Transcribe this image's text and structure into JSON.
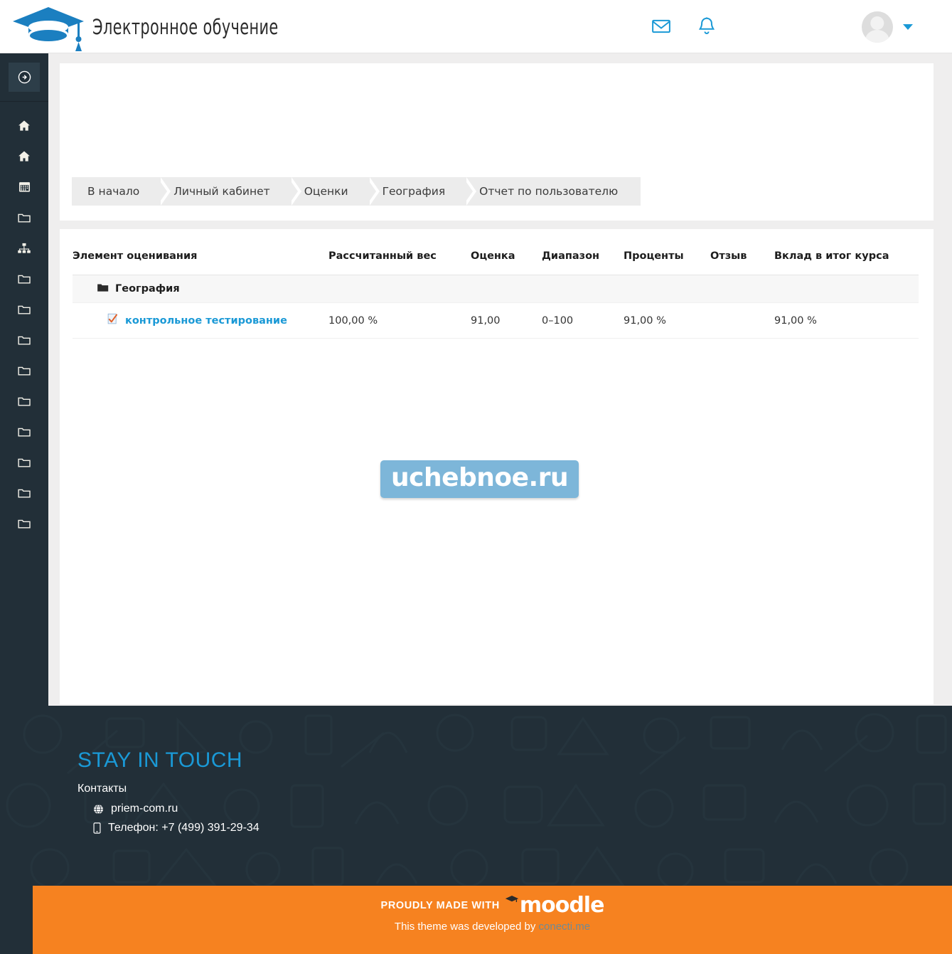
{
  "header": {
    "brand_name": "Электронное обучение",
    "logo_icon": "graduation-cap-icon",
    "messages_icon": "envelope-icon",
    "notifications_icon": "bell-icon",
    "avatar_icon": "user-avatar-icon",
    "caret_icon": "chevron-down-icon"
  },
  "sidebar": {
    "toggle_icon": "arrow-right-circle-icon",
    "items": [
      {
        "icon": "home-icon",
        "name": "sidebar-item-home"
      },
      {
        "icon": "home-icon",
        "name": "sidebar-item-dashboard"
      },
      {
        "icon": "calendar-icon",
        "name": "sidebar-item-calendar"
      },
      {
        "icon": "folder-icon",
        "name": "sidebar-item-course-1"
      },
      {
        "icon": "sitemap-icon",
        "name": "sidebar-item-sitemap"
      },
      {
        "icon": "folder-icon",
        "name": "sidebar-item-course-2"
      },
      {
        "icon": "folder-icon",
        "name": "sidebar-item-course-3"
      },
      {
        "icon": "folder-icon",
        "name": "sidebar-item-course-4"
      },
      {
        "icon": "folder-icon",
        "name": "sidebar-item-course-5"
      },
      {
        "icon": "folder-icon",
        "name": "sidebar-item-course-6"
      },
      {
        "icon": "folder-icon",
        "name": "sidebar-item-course-7"
      },
      {
        "icon": "folder-icon",
        "name": "sidebar-item-course-8"
      },
      {
        "icon": "folder-icon",
        "name": "sidebar-item-course-9"
      },
      {
        "icon": "folder-icon",
        "name": "sidebar-item-course-10"
      }
    ]
  },
  "profile": {
    "avatar_icon": "user-avatar-placeholder-icon"
  },
  "breadcrumb": [
    {
      "label": "В начало"
    },
    {
      "label": "Личный кабинет"
    },
    {
      "label": "Оценки"
    },
    {
      "label": "География"
    },
    {
      "label": "Отчет по пользователю"
    }
  ],
  "grade_table": {
    "columns": [
      "Элемент оценивания",
      "Рассчитанный вес",
      "Оценка",
      "Диапазон",
      "Проценты",
      "Отзыв",
      "Вклад в итог курса"
    ],
    "category": {
      "label": "География",
      "icon": "folder-icon"
    },
    "rows": [
      {
        "name": "контрольное тестирование",
        "icon": "quiz-icon",
        "weight": "100,00 %",
        "grade": "91,00",
        "range": "0–100",
        "percentage": "91,00 %",
        "feedback": "",
        "contribution": "91,00 %"
      }
    ]
  },
  "watermark": {
    "text": "uchebnoe.ru"
  },
  "footer": {
    "title": "STAY IN TOUCH",
    "contacts_label": "Контакты",
    "website_icon": "globe-icon",
    "website": "priem-com.ru",
    "phone_icon": "mobile-phone-icon",
    "phone": "Телефон: +7 (499) 391-29-34"
  },
  "orange_bar": {
    "proudly_text": "PROUDLY MADE WITH",
    "moodle_text": "moodle",
    "moodle_cap_icon": "graduation-cap-icon",
    "theme_prefix": "This theme was developed by ",
    "theme_link": "conecti.me"
  },
  "colors": {
    "brand_blue": "#1a99d6",
    "dark_navy": "#222f38",
    "orange": "#f68220",
    "watermark_blue": "#7db6d9",
    "content_bg": "#efeeee"
  }
}
